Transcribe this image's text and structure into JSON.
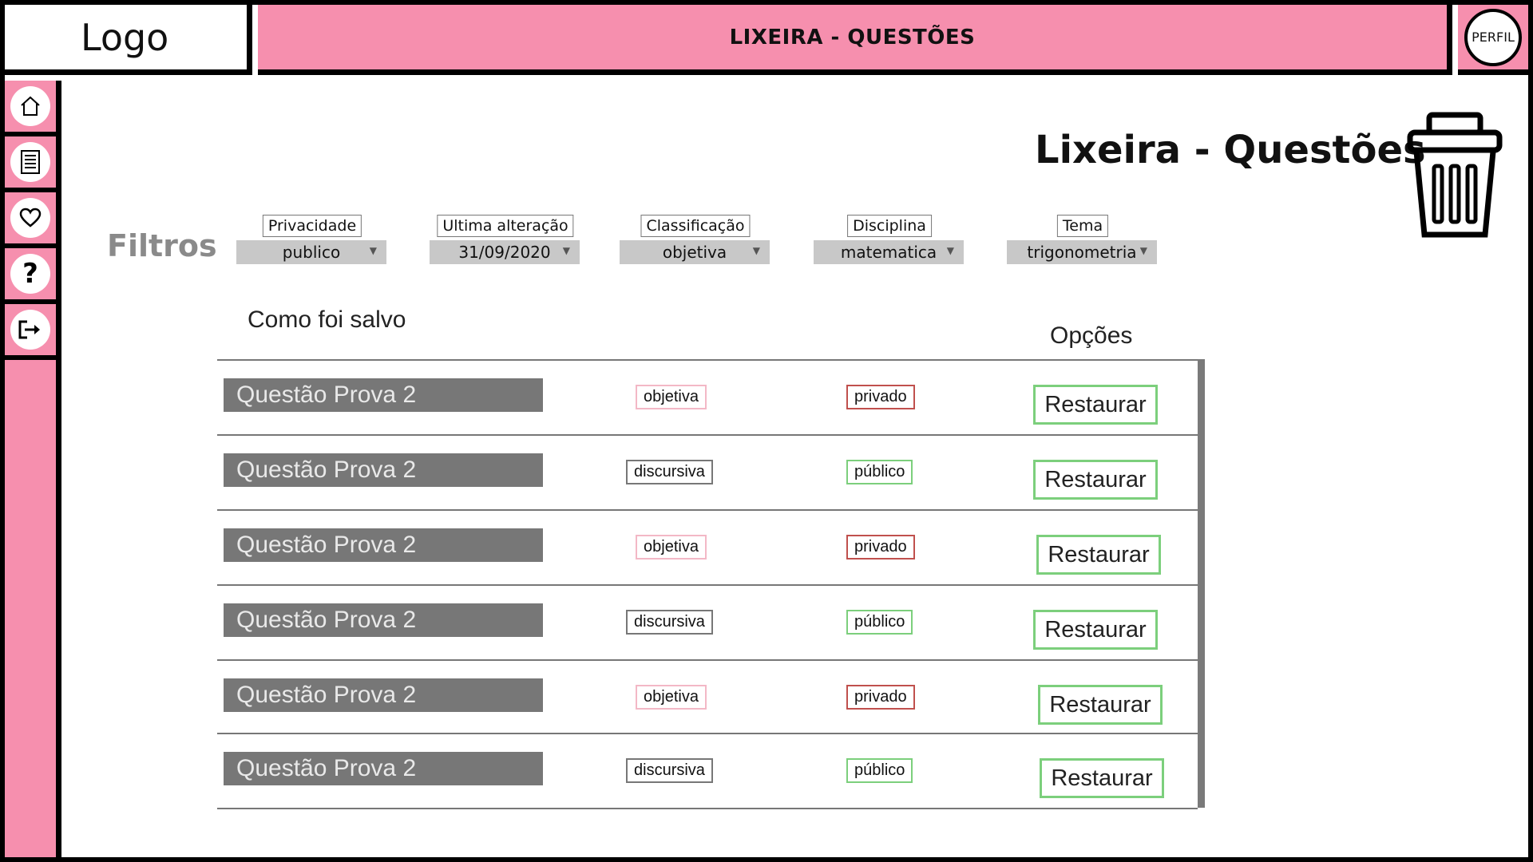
{
  "header": {
    "logo": "Logo",
    "title": "LIXEIRA - QUESTÕES",
    "profile_label": "PERFIL"
  },
  "sidebar": {
    "items": [
      {
        "icon": "home-icon"
      },
      {
        "icon": "document-icon"
      },
      {
        "icon": "heart-icon"
      },
      {
        "icon": "help-icon",
        "glyph": "?"
      },
      {
        "icon": "logout-icon"
      }
    ]
  },
  "main": {
    "title": "Lixeira - Questões",
    "filters_label": "Filtros",
    "filters": [
      {
        "label": "Privacidade",
        "value": "publico"
      },
      {
        "label": "Ultima alteração",
        "value": "31/09/2020"
      },
      {
        "label": "Classificação",
        "value": "objetiva"
      },
      {
        "label": "Disciplina",
        "value": "matematica"
      },
      {
        "label": "Tema",
        "value": "trigonometria"
      }
    ],
    "columns": {
      "saved": "Como foi salvo",
      "options": "Opções"
    },
    "rows": [
      {
        "name": "Questão Prova 2",
        "type": "objetiva",
        "privacy": "privado",
        "action": "Restaurar"
      },
      {
        "name": "Questão Prova 2",
        "type": "discursiva",
        "privacy": "público",
        "action": "Restaurar"
      },
      {
        "name": "Questão Prova 2",
        "type": "objetiva",
        "privacy": "privado",
        "action": "Restaurar"
      },
      {
        "name": "Questão Prova 2",
        "type": "discursiva",
        "privacy": "público",
        "action": "Restaurar"
      },
      {
        "name": "Questão Prova 2",
        "type": "objetiva",
        "privacy": "privado",
        "action": "Restaurar"
      },
      {
        "name": "Questão Prova 2",
        "type": "discursiva",
        "privacy": "público",
        "action": "Restaurar"
      }
    ]
  },
  "colors": {
    "accent_pink": "#f68fae",
    "row_bar": "#777777",
    "restore_border": "#7ccf7c",
    "private_border": "#c0504d",
    "objective_border": "#f3b8c6"
  }
}
